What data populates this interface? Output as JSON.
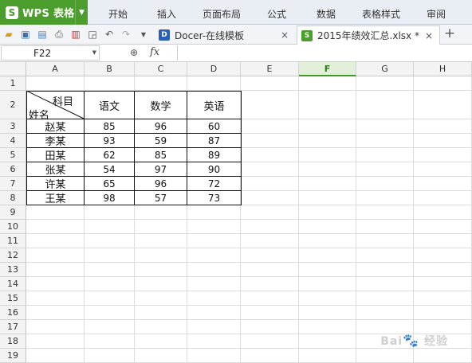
{
  "app": {
    "brand": "WPS 表格"
  },
  "menu": [
    "开始",
    "插入",
    "页面布局",
    "公式",
    "数据",
    "表格样式",
    "审阅"
  ],
  "tabs": [
    {
      "label": "Docer-在线模板",
      "close": "×"
    },
    {
      "label": "2015年绩效汇总.xlsx *",
      "close": "×"
    }
  ],
  "add_tab": "+",
  "formula_bar": {
    "name_box": "F22",
    "fx": "fx",
    "formula": ""
  },
  "columns": [
    "A",
    "B",
    "C",
    "D",
    "E",
    "F",
    "G",
    "H"
  ],
  "selected_column": "F",
  "rows": [
    "1",
    "2",
    "3",
    "4",
    "5",
    "6",
    "7",
    "8",
    "9",
    "10",
    "11",
    "12",
    "13",
    "14",
    "15",
    "16",
    "17",
    "18",
    "19"
  ],
  "table": {
    "header_top": "科目",
    "header_bottom": "姓名",
    "subjects": [
      "语文",
      "数学",
      "英语"
    ],
    "records": [
      {
        "name": "赵某",
        "scores": [
          "85",
          "96",
          "60"
        ]
      },
      {
        "name": "李某",
        "scores": [
          "93",
          "59",
          "87"
        ]
      },
      {
        "name": "田某",
        "scores": [
          "62",
          "85",
          "89"
        ]
      },
      {
        "name": "张某",
        "scores": [
          "54",
          "97",
          "90"
        ]
      },
      {
        "name": "许某",
        "scores": [
          "65",
          "96",
          "72"
        ]
      },
      {
        "name": "王某",
        "scores": [
          "98",
          "57",
          "73"
        ]
      }
    ]
  },
  "watermark": "Baidu 经验",
  "colors": {
    "brand_green": "#4b9d2d",
    "selected_col_bg": "#e3f0d9"
  }
}
